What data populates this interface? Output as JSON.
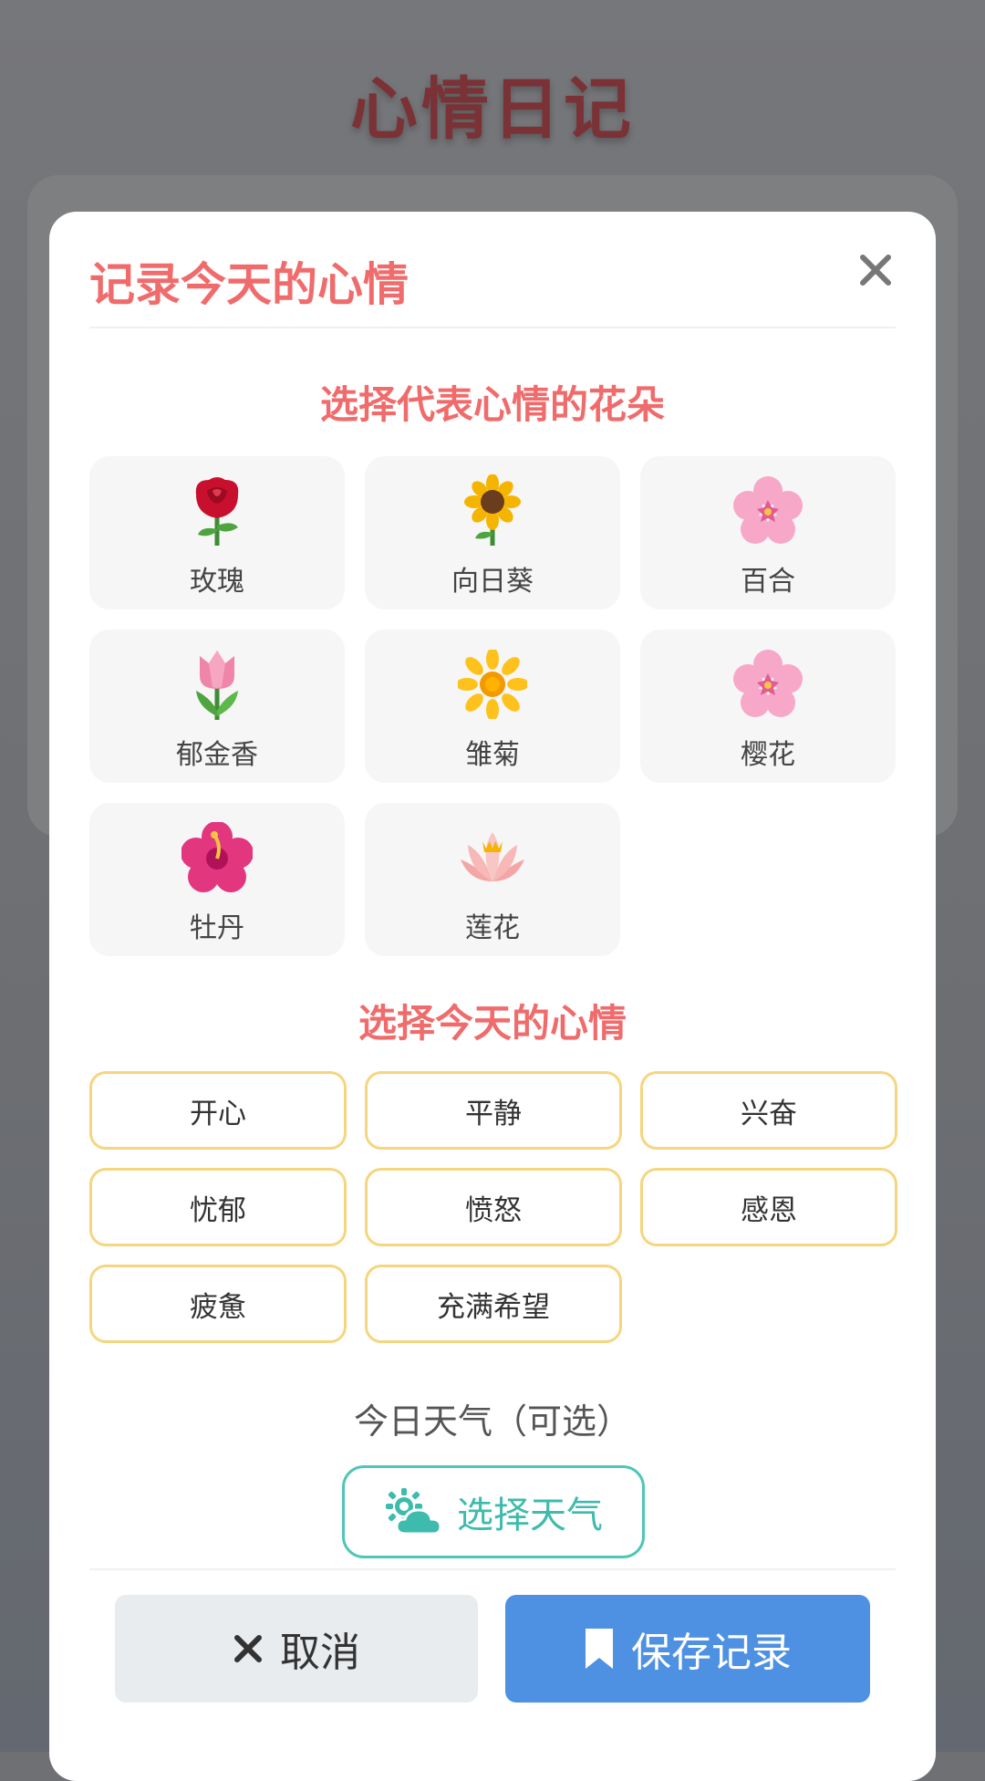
{
  "background": {
    "app_title": "心情日记"
  },
  "modal": {
    "title": "记录今天的心情",
    "close_icon": "close-icon",
    "flower_section_title": "选择代表心情的花朵",
    "flowers": [
      {
        "label": "玫瑰",
        "icon": "rose-icon",
        "color": "#c8102e"
      },
      {
        "label": "向日葵",
        "icon": "sunflower-icon",
        "color": "#f5b400"
      },
      {
        "label": "百合",
        "icon": "lily-icon",
        "color": "#f7a8c9"
      },
      {
        "label": "郁金香",
        "icon": "tulip-icon",
        "color": "#ef86aa"
      },
      {
        "label": "雏菊",
        "icon": "daisy-icon",
        "color": "#ffc21c"
      },
      {
        "label": "樱花",
        "icon": "cherry-blossom-icon",
        "color": "#f7a8c9"
      },
      {
        "label": "牡丹",
        "icon": "peony-icon",
        "color": "#e2367f"
      },
      {
        "label": "莲花",
        "icon": "lotus-icon",
        "color": "#f4a6a6"
      }
    ],
    "mood_section_title": "选择今天的心情",
    "moods": [
      "开心",
      "平静",
      "兴奋",
      "忧郁",
      "愤怒",
      "感恩",
      "疲惫",
      "充满希望"
    ],
    "weather_label": "今日天气（可选）",
    "weather_button": "选择天气",
    "cancel_button": "取消",
    "save_button": "保存记录"
  },
  "colors": {
    "accent": "#f06b6b",
    "mood_border": "#f6d57e",
    "weather": "#4fc6b8",
    "save": "#4e91e3",
    "cancel_bg": "#e8ecef"
  }
}
